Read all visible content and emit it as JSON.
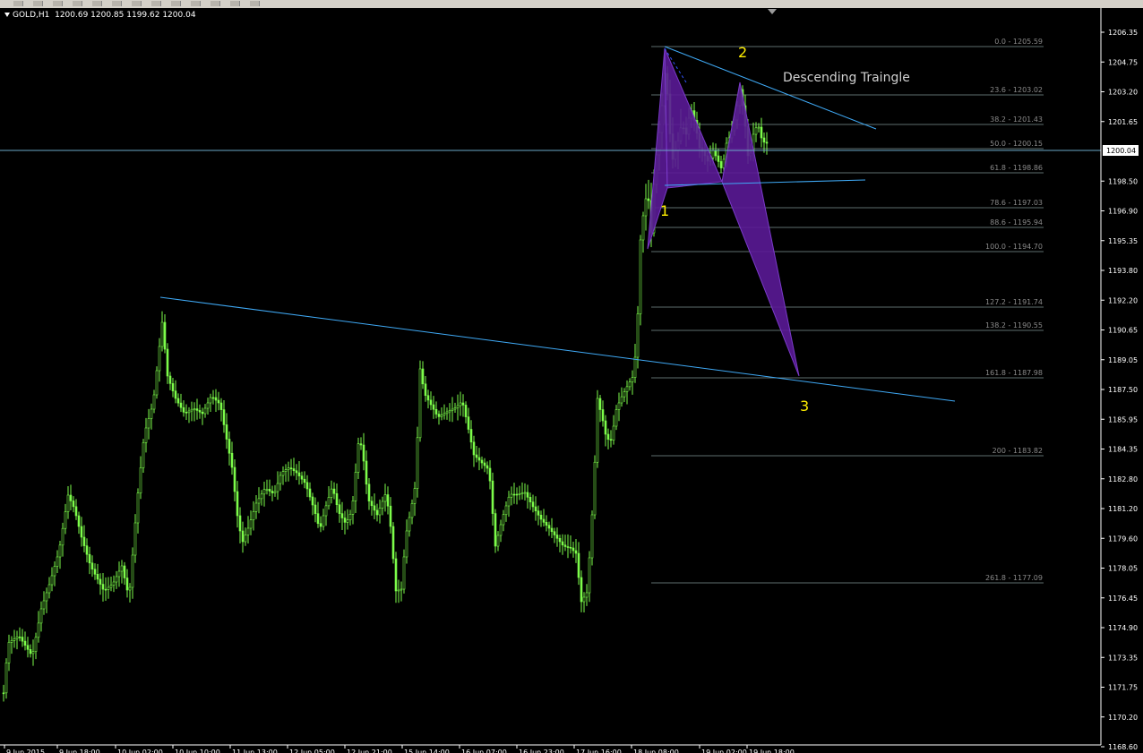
{
  "toolbar": {
    "icons": [
      "new-chart-icon",
      "profiles-icon",
      "market-watch-icon",
      "navigator-icon",
      "terminal-icon",
      "tester-icon",
      "new-order-icon",
      "expert-advisors-icon",
      "zoom-in-icon",
      "zoom-out-icon",
      "grid-icon",
      "period-icon",
      "templates-icon"
    ]
  },
  "chart_header": {
    "symbol": "GOLD,H1",
    "ohlc": "1200.69 1200.85 1199.62 1200.04"
  },
  "current_price": "1200.04",
  "price_axis": {
    "labels": [
      "1206.35",
      "1204.75",
      "1203.20",
      "1201.65",
      "1200.04",
      "1198.50",
      "1196.90",
      "1195.35",
      "1193.80",
      "1192.20",
      "1190.65",
      "1189.05",
      "1187.50",
      "1185.95",
      "1184.35",
      "1182.80",
      "1181.20",
      "1179.60",
      "1178.05",
      "1176.45",
      "1174.90",
      "1173.35",
      "1171.75",
      "1170.20",
      "1168.60"
    ]
  },
  "time_axis": {
    "labels": [
      "9 Jun 2015",
      "9 Jun 18:00",
      "10 Jun 02:00",
      "10 Jun 10:00",
      "11 Jun 13:00",
      "12 Jun 05:00",
      "12 Jun 21:00",
      "15 Jun 14:00",
      "16 Jun 07:00",
      "16 Jun 23:00",
      "17 Jun 16:00",
      "18 Jun 08:00",
      "19 Jun 02:00",
      "19 Jun 18:00"
    ]
  },
  "fibonacci": {
    "levels": [
      "0.0 - 1205.59",
      "23.6 - 1203.02",
      "38.2 - 1201.43",
      "50.0 - 1200.15",
      "61.8 - 1198.86",
      "78.6 - 1197.03",
      "88.6 - 1195.94",
      "100.0 - 1194.70",
      "127.2 - 1191.74",
      "138.2 - 1190.55",
      "161.8 - 1187.98",
      "200 - 1183.82",
      "261.8 - 1177.09"
    ]
  },
  "annotations": {
    "point1": "1",
    "point2": "2",
    "point3": "3",
    "pattern_label": "Descending Traingle"
  },
  "colors": {
    "background": "#000000",
    "candle": "#7CFC4A",
    "trendline": "#3fa9f5",
    "pattern_fill": "#5a1a96",
    "fib_line": "#5e6e6e",
    "annotation_number": "#ffee00",
    "price_line": "#6aa9c9"
  }
}
